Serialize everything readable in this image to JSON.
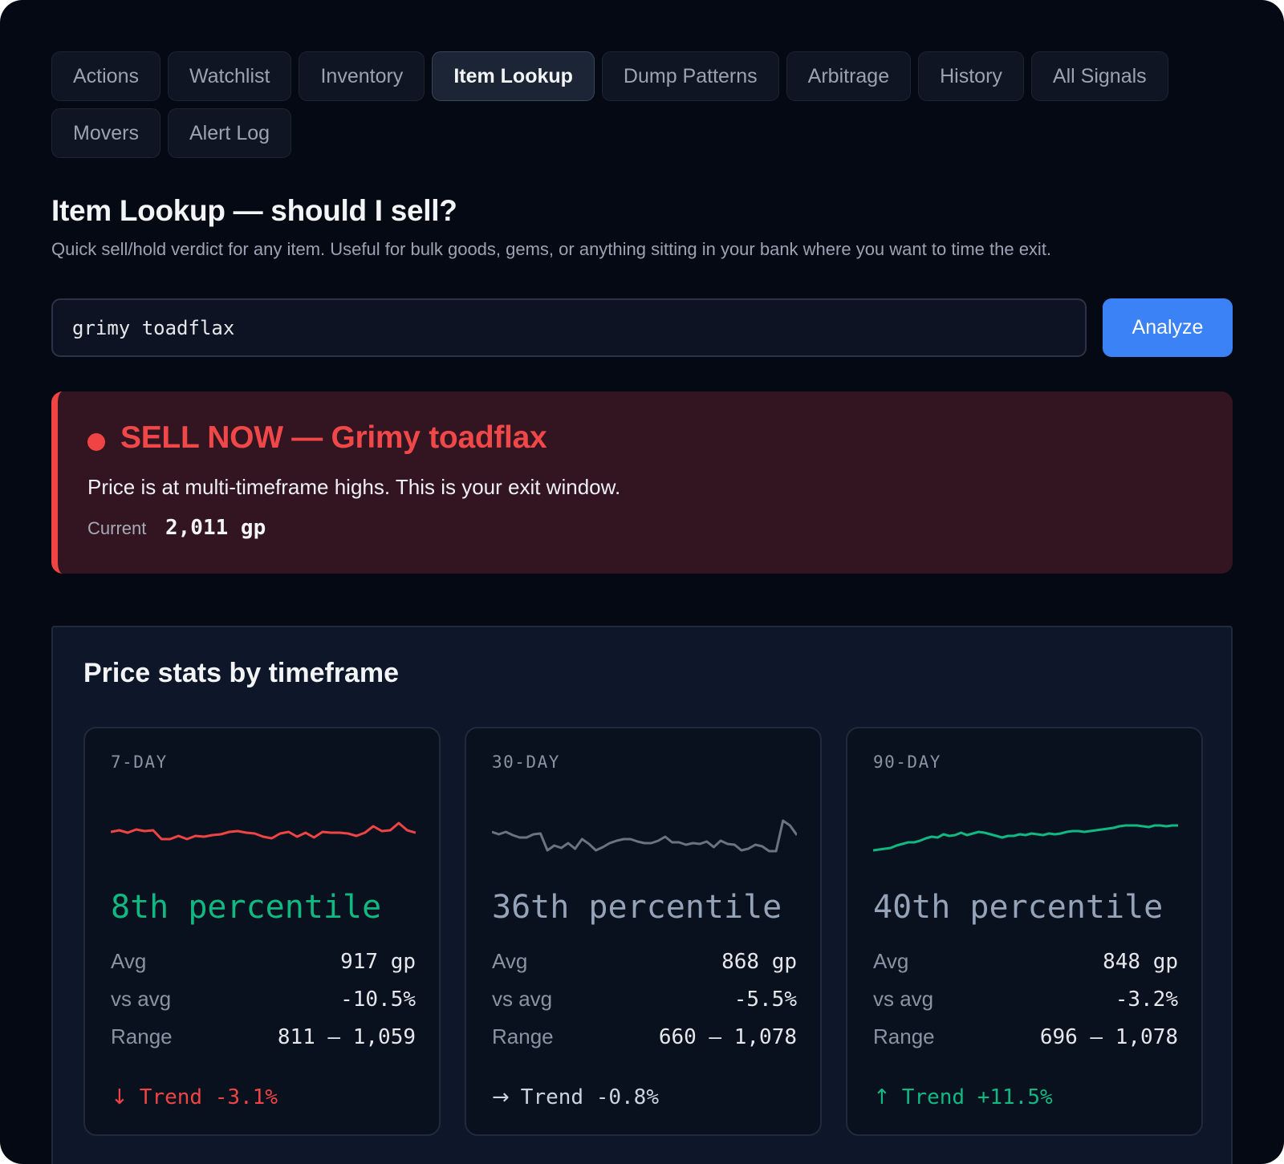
{
  "tabs": [
    {
      "label": "Actions",
      "active": false
    },
    {
      "label": "Watchlist",
      "active": false
    },
    {
      "label": "Inventory",
      "active": false
    },
    {
      "label": "Item Lookup",
      "active": true
    },
    {
      "label": "Dump Patterns",
      "active": false
    },
    {
      "label": "Arbitrage",
      "active": false
    },
    {
      "label": "History",
      "active": false
    },
    {
      "label": "All Signals",
      "active": false
    },
    {
      "label": "Movers",
      "active": false
    },
    {
      "label": "Alert Log",
      "active": false
    }
  ],
  "page": {
    "title": "Item Lookup — should I sell?",
    "subtitle": "Quick sell/hold verdict for any item. Useful for bulk goods, gems, or anything sitting in your bank where you want to time the exit."
  },
  "search": {
    "value": "grimy toadflax",
    "button_label": "Analyze"
  },
  "verdict": {
    "title": "SELL NOW — Grimy toadflax",
    "message": "Price is at multi-timeframe highs. This is your exit window.",
    "current_label": "Current",
    "current_value": "2,011 gp",
    "color": "#ef4444"
  },
  "stats": {
    "title": "Price stats by timeframe",
    "cards": [
      {
        "label": "7-DAY",
        "percentile": "8th percentile",
        "percentile_color": "#10b981",
        "spark_color": "#ef4444",
        "spark": [
          44,
          42,
          45,
          41,
          43,
          42,
          53,
          53,
          49,
          53,
          49,
          50,
          48,
          47,
          44,
          43,
          45,
          46,
          50,
          52,
          46,
          44,
          50,
          45,
          51,
          44,
          45,
          45,
          46,
          49,
          45,
          37,
          43,
          42,
          33,
          42,
          45
        ],
        "avg_label": "Avg",
        "avg": "917 gp",
        "vs_label": "vs avg",
        "vs": "-10.5%",
        "range_label": "Range",
        "range": "811 – 1,059",
        "trend_arrow": "↓",
        "trend": "Trend -3.1%",
        "trend_color": "#ef4444"
      },
      {
        "label": "30-DAY",
        "percentile": "36th percentile",
        "percentile_color": "#94a3b8",
        "spark_color": "#6b7280",
        "spark": [
          44,
          47,
          44,
          48,
          51,
          51,
          47,
          46,
          67,
          61,
          64,
          58,
          65,
          53,
          59,
          67,
          63,
          58,
          55,
          53,
          53,
          56,
          58,
          58,
          55,
          50,
          57,
          57,
          60,
          58,
          59,
          56,
          63,
          55,
          59,
          60,
          67,
          65,
          60,
          62,
          68,
          68,
          30,
          36,
          48
        ],
        "avg_label": "Avg",
        "avg": "868 gp",
        "vs_label": "vs avg",
        "vs": "-5.5%",
        "range_label": "Range",
        "range": "660 – 1,078",
        "trend_arrow": "→",
        "trend": "Trend -0.8%",
        "trend_color": "#cbd5e1"
      },
      {
        "label": "90-DAY",
        "percentile": "40th percentile",
        "percentile_color": "#94a3b8",
        "spark_color": "#10b981",
        "spark": [
          67,
          66,
          65,
          64,
          61,
          59,
          57,
          57,
          55,
          52,
          50,
          51,
          47,
          49,
          48,
          45,
          48,
          46,
          44,
          45,
          47,
          49,
          51,
          49,
          49,
          47,
          48,
          46,
          47,
          48,
          46,
          47,
          46,
          44,
          43,
          43,
          44,
          43,
          42,
          41,
          40,
          39,
          37,
          36,
          36,
          36,
          37,
          38,
          36,
          36,
          37,
          36,
          36
        ],
        "avg_label": "Avg",
        "avg": "848 gp",
        "vs_label": "vs avg",
        "vs": "-3.2%",
        "range_label": "Range",
        "range": "696 – 1,078",
        "trend_arrow": "↑",
        "trend": "Trend +11.5%",
        "trend_color": "#10b981"
      }
    ]
  }
}
